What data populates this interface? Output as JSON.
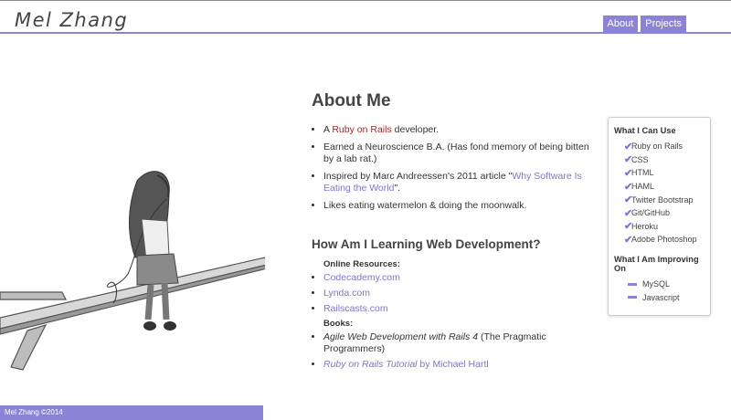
{
  "header": {
    "brand": "Mel Zhang",
    "nav": [
      {
        "label": "About"
      },
      {
        "label": "Projects"
      }
    ]
  },
  "about": {
    "title": "About Me",
    "facts": {
      "f1_prefix": "A ",
      "f1_link": "Ruby on Rails",
      "f1_suffix": " developer.",
      "f2": "Earned a Neuroscience B.A. (Has fond memory of being bitten by a lab rat.)",
      "f3_prefix": "Inspired by Marc Andreessen's 2011 article \"",
      "f3_link": "Why Software Is Eating the World",
      "f3_suffix": "\".",
      "f4": "Likes eating watermelon & doing the moonwalk."
    }
  },
  "learning": {
    "title": "How Am I Learning Web Development?",
    "online_label": "Online Resources:",
    "online": [
      "Codecademy.com",
      "Lynda.com",
      "Railscasts.com"
    ],
    "books_label": "Books:",
    "book1_title": "Agile Web Development with Rails 4",
    "book1_suffix": " (The Pragmatic Programmers)",
    "book2_title": "Ruby on Rails Tutorial",
    "book2_suffix": "  by Michael Hartl"
  },
  "sidebar": {
    "can_use_title": "What I Can Use",
    "can_use": [
      "Ruby on Rails",
      "CSS",
      "HTML",
      "HAML",
      "Twitter Bootstrap",
      "Git/GitHub",
      "Heroku",
      "Adobe Photoshop"
    ],
    "improving_title": "What I Am Improving On",
    "improving": [
      "MySQL",
      "Javascript"
    ]
  },
  "footer": {
    "text": "Mel Zhang ©2014"
  },
  "colors": {
    "accent": "#8b84d6",
    "link": "#7b76d8",
    "ruby": "#b22222"
  }
}
